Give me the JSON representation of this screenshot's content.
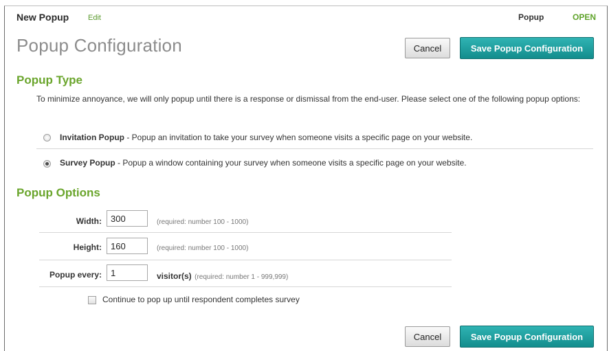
{
  "header": {
    "title": "New Popup",
    "edit_label": "Edit",
    "crumb": "Popup",
    "status": "OPEN"
  },
  "page": {
    "title": "Popup Configuration"
  },
  "actions": {
    "cancel_label": "Cancel",
    "save_label": "Save Popup Configuration"
  },
  "popup_type": {
    "heading": "Popup Type",
    "description": "To minimize annoyance, we will only popup until there is a response or dismissal from the end-user.  Please select one of the following popup options:",
    "options": [
      {
        "name": "Invitation Popup",
        "text": " - Popup an invitation to take your survey when someone visits a specific page on your website.",
        "selected": false
      },
      {
        "name": "Survey Popup",
        "text": " - Popup a window containing your survey when someone visits a specific page on your website.",
        "selected": true
      }
    ]
  },
  "popup_options": {
    "heading": "Popup Options",
    "width": {
      "label": "Width:",
      "value": "300",
      "hint": "(required: number 100 - 1000)"
    },
    "height": {
      "label": "Height:",
      "value": "160",
      "hint": "(required: number 100 - 1000)"
    },
    "every": {
      "label": "Popup every:",
      "value": "1",
      "unit": "visitor(s)",
      "hint": "(required: number 1 - 999,999)"
    },
    "continue": {
      "label": "Continue to pop up until respondent completes survey",
      "checked": false
    }
  },
  "colors": {
    "accent_green": "#6aa52c",
    "button_teal": "#1a9c9c",
    "status_green": "#5fa32a"
  }
}
